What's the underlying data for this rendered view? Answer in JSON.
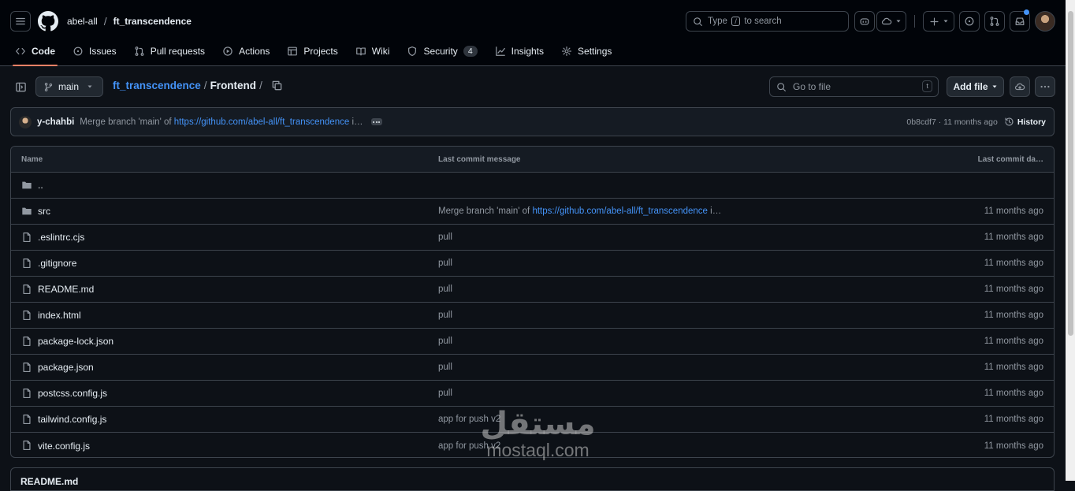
{
  "header": {
    "owner": "abel-all",
    "separator": "/",
    "repo": "ft_transcendence",
    "search_prefix": "Type",
    "search_key": "/",
    "search_suffix": "to search"
  },
  "nav": {
    "tabs": [
      {
        "label": "Code",
        "icon": "code-icon",
        "active": true
      },
      {
        "label": "Issues",
        "icon": "issue-icon"
      },
      {
        "label": "Pull requests",
        "icon": "pull-request-icon"
      },
      {
        "label": "Actions",
        "icon": "play-icon"
      },
      {
        "label": "Projects",
        "icon": "table-icon"
      },
      {
        "label": "Wiki",
        "icon": "book-icon"
      },
      {
        "label": "Security",
        "icon": "shield-icon",
        "counter": "4"
      },
      {
        "label": "Insights",
        "icon": "graph-icon"
      },
      {
        "label": "Settings",
        "icon": "gear-icon"
      }
    ]
  },
  "toolbar": {
    "branch": "main",
    "breadcrumb_repo": "ft_transcendence",
    "breadcrumb_sep": "/",
    "breadcrumb_current": "Frontend",
    "breadcrumb_trail": "/",
    "goto_placeholder": "Go to file",
    "goto_key": "t",
    "add_file": "Add file"
  },
  "commit": {
    "user": "y-chahbi",
    "message_prefix": "Merge branch 'main' of",
    "message_link": "https://github.com/abel-all/ft_transcendence",
    "message_suffix": "i…",
    "meta": "0b8cdf7 · 11 months ago",
    "history": "History"
  },
  "table": {
    "headers": {
      "name": "Name",
      "message": "Last commit message",
      "date": "Last commit da…"
    },
    "rows": [
      {
        "name": "..",
        "type": "folder",
        "message": "",
        "date": ""
      },
      {
        "name": "src",
        "type": "folder",
        "message": "Merge branch 'main' of",
        "link": "https://github.com/abel-all/ft_transcendence",
        "suffix": "i…",
        "date": "11 months ago"
      },
      {
        "name": ".eslintrc.cjs",
        "type": "file",
        "message": "pull",
        "date": "11 months ago"
      },
      {
        "name": ".gitignore",
        "type": "file",
        "message": "pull",
        "date": "11 months ago"
      },
      {
        "name": "README.md",
        "type": "file",
        "message": "pull",
        "date": "11 months ago"
      },
      {
        "name": "index.html",
        "type": "file",
        "message": "pull",
        "date": "11 months ago"
      },
      {
        "name": "package-lock.json",
        "type": "file",
        "message": "pull",
        "date": "11 months ago"
      },
      {
        "name": "package.json",
        "type": "file",
        "message": "pull",
        "date": "11 months ago"
      },
      {
        "name": "postcss.config.js",
        "type": "file",
        "message": "pull",
        "date": "11 months ago"
      },
      {
        "name": "tailwind.config.js",
        "type": "file",
        "message": "app for push v2",
        "date": "11 months ago"
      },
      {
        "name": "vite.config.js",
        "type": "file",
        "message": "app for push v2",
        "date": "11 months ago"
      }
    ]
  },
  "readme": {
    "title": "README.md"
  },
  "watermark": {
    "arabic": "مستقل",
    "latin": "mostaql.com"
  },
  "colors": {
    "background": "#0d1117",
    "header": "#010409",
    "border": "#3d444d",
    "link": "#4493f8",
    "active_tab": "#f78166",
    "muted": "#9198a1"
  }
}
